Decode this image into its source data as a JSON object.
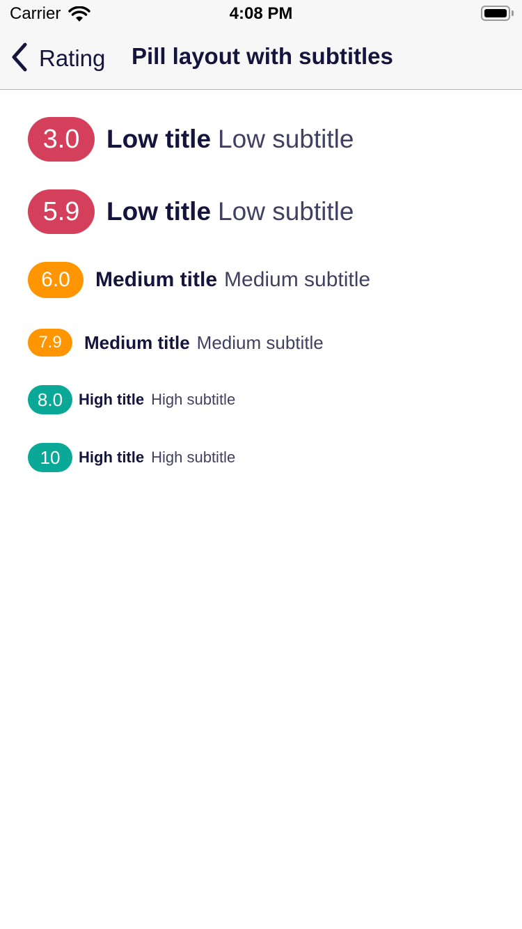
{
  "status_bar": {
    "carrier": "Carrier",
    "time": "4:08 PM",
    "icons": [
      "wifi-icon",
      "battery-icon"
    ]
  },
  "nav": {
    "back_label": "Rating",
    "title": "Pill layout with subtitles",
    "icons": [
      "chevron-left-icon"
    ]
  },
  "colors": {
    "low": "#d43f5c",
    "medium": "#ff9500",
    "high": "#0aa896"
  },
  "ratings": [
    {
      "value": "3.0",
      "title": "Low title",
      "subtitle": "Low subtitle",
      "level": "low"
    },
    {
      "value": "5.9",
      "title": "Low title",
      "subtitle": "Low subtitle",
      "level": "low"
    },
    {
      "value": "6.0",
      "title": "Medium title",
      "subtitle": "Medium subtitle",
      "level": "medium"
    },
    {
      "value": "7.9",
      "title": "Medium title",
      "subtitle": "Medium subtitle",
      "level": "medium"
    },
    {
      "value": "8.0",
      "title": "High title",
      "subtitle": "High subtitle",
      "level": "high"
    },
    {
      "value": "10",
      "title": "High title",
      "subtitle": "High subtitle",
      "level": "high"
    }
  ]
}
